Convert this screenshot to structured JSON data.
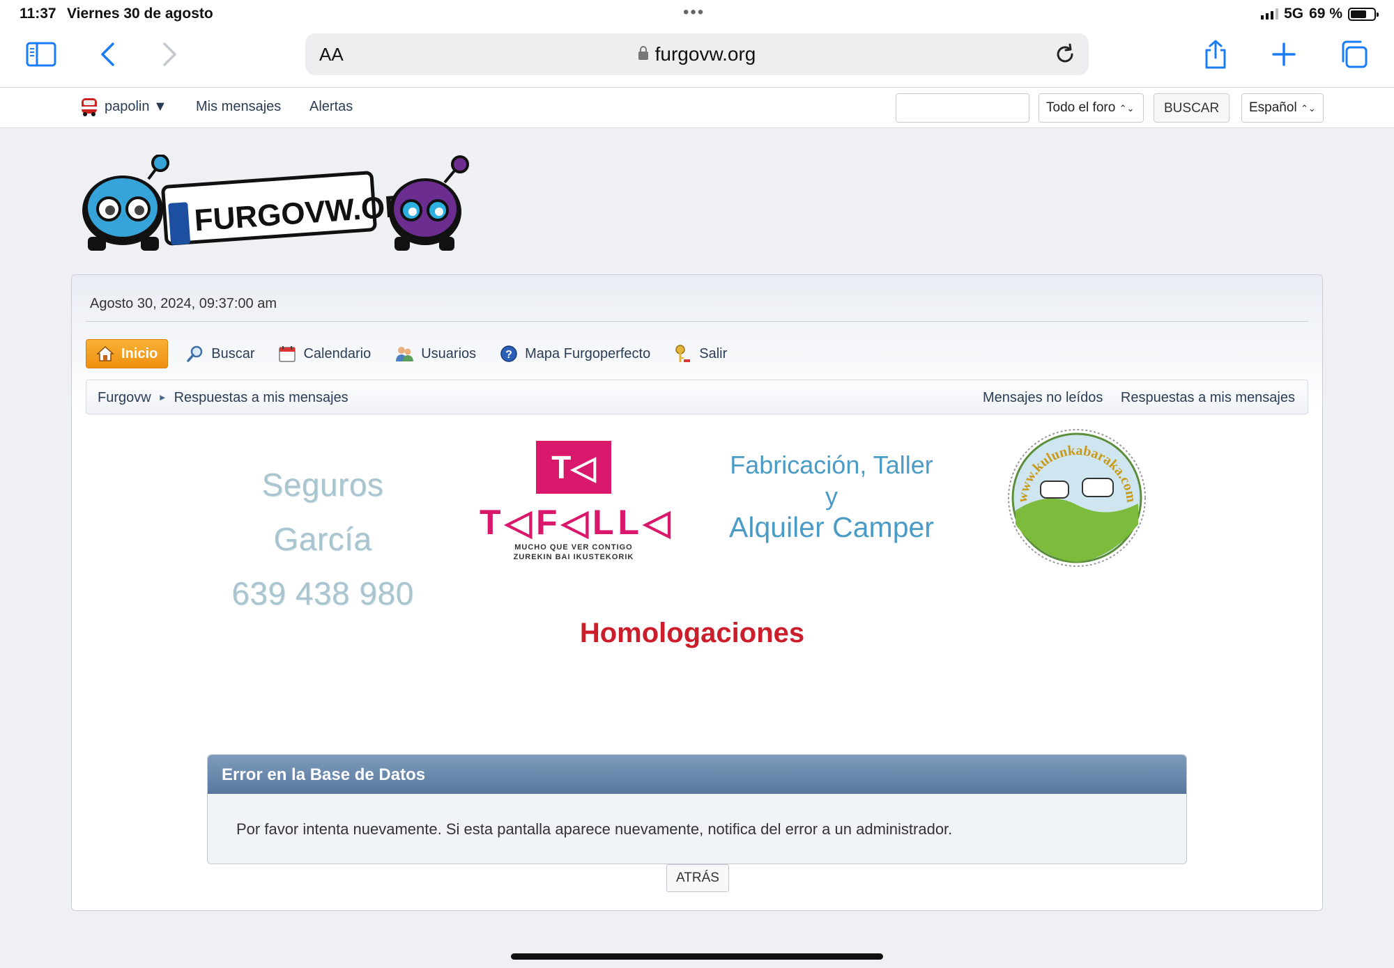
{
  "status_bar": {
    "time": "11:37",
    "date": "Viernes 30 de agosto",
    "signal": "5G",
    "battery": "69 %",
    "battery_level": 0.69
  },
  "browser": {
    "text_size_label": "AA",
    "domain": "furgovw.org"
  },
  "userbar": {
    "username": "papolin ▼",
    "messages": "Mis mensajes",
    "alerts": "Alertas",
    "search_scope": "Todo el foro",
    "search_button": "BUSCAR",
    "language": "Español"
  },
  "header": {
    "logo_text": "FURGOVW.ORG",
    "datetime": "Agosto 30, 2024, 09:37:00 am"
  },
  "menu": [
    {
      "label": "Inicio",
      "icon": "home-icon"
    },
    {
      "label": "Buscar",
      "icon": "magnifier-icon"
    },
    {
      "label": "Calendario",
      "icon": "calendar-icon"
    },
    {
      "label": "Usuarios",
      "icon": "users-icon"
    },
    {
      "label": "Mapa Furgoperfecto",
      "icon": "help-icon"
    },
    {
      "label": "Salir",
      "icon": "key-icon"
    }
  ],
  "breadcrumb": {
    "root": "Furgovw",
    "separator": "►",
    "current": "Respuestas a mis mensajes",
    "link_unread": "Mensajes no leídos",
    "link_replies": "Respuestas a mis mensajes"
  },
  "sponsors": {
    "seguros_line1": "Seguros García",
    "seguros_line2": "639 438 980",
    "tafalla_mark": "T◁",
    "tafalla_word": "T◁F◁LL◁",
    "tafalla_sub1": "MUCHO QUE VER CONTIGO",
    "tafalla_sub2": "ZUREKIN BAI IKUSTEKORIK",
    "fabric_line1": "Fabricación, Taller",
    "fabric_line2": "y",
    "fabric_line3": "Alquiler Camper",
    "kuluka": "www.kulunkabaraka.com",
    "homologaciones": "Homologaciones"
  },
  "error": {
    "title": "Error en la Base de Datos",
    "message": "Por favor intenta nuevamente. Si esta pantalla aparece nuevamente, notifica del error a un administrador.",
    "back_button": "ATRÁS"
  },
  "colors": {
    "accent_blue": "#1a7cf5",
    "home_orange": "#ef8f10",
    "error_header": "#58789e",
    "tafalla_pink": "#d9186b",
    "homolog_red": "#cc1d2b"
  }
}
